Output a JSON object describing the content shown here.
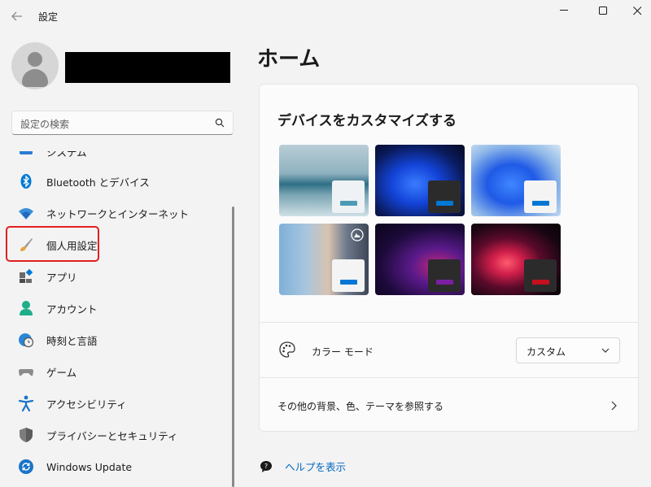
{
  "window": {
    "title": "設定"
  },
  "sidebar": {
    "search_placeholder": "設定の検索",
    "items": [
      {
        "label": "システム",
        "icon": "system-icon"
      },
      {
        "label": "Bluetooth とデバイス",
        "icon": "bluetooth-icon"
      },
      {
        "label": "ネットワークとインターネット",
        "icon": "wifi-icon"
      },
      {
        "label": "個人用設定",
        "icon": "brush-icon"
      },
      {
        "label": "アプリ",
        "icon": "apps-icon",
        "highlighted": true
      },
      {
        "label": "アカウント",
        "icon": "account-icon"
      },
      {
        "label": "時刻と言語",
        "icon": "globe-clock-icon"
      },
      {
        "label": "ゲーム",
        "icon": "gamepad-icon"
      },
      {
        "label": "アクセシビリティ",
        "icon": "accessibility-icon"
      },
      {
        "label": "プライバシーとセキュリティ",
        "icon": "shield-icon"
      },
      {
        "label": "Windows Update",
        "icon": "update-icon"
      }
    ]
  },
  "main": {
    "title": "ホーム",
    "card": {
      "title": "デバイスをカスタマイズする",
      "themes": [
        {
          "name": "lake",
          "accent": "#4a9bb5"
        },
        {
          "name": "bloom-dark",
          "accent": "#0078d4"
        },
        {
          "name": "bloom-light",
          "accent": "#0078d4"
        },
        {
          "name": "spotlight",
          "accent": "#0078d4"
        },
        {
          "name": "glow",
          "accent": "#7a1fa2"
        },
        {
          "name": "flow",
          "accent": "#c50f1f"
        }
      ],
      "color_mode_label": "カラー モード",
      "color_mode_value": "カスタム",
      "browse_label": "その他の背景、色、テーマを参照する"
    },
    "help_label": "ヘルプを表示"
  },
  "colors": {
    "accent": "#0067c0",
    "highlight": "#e02020"
  }
}
